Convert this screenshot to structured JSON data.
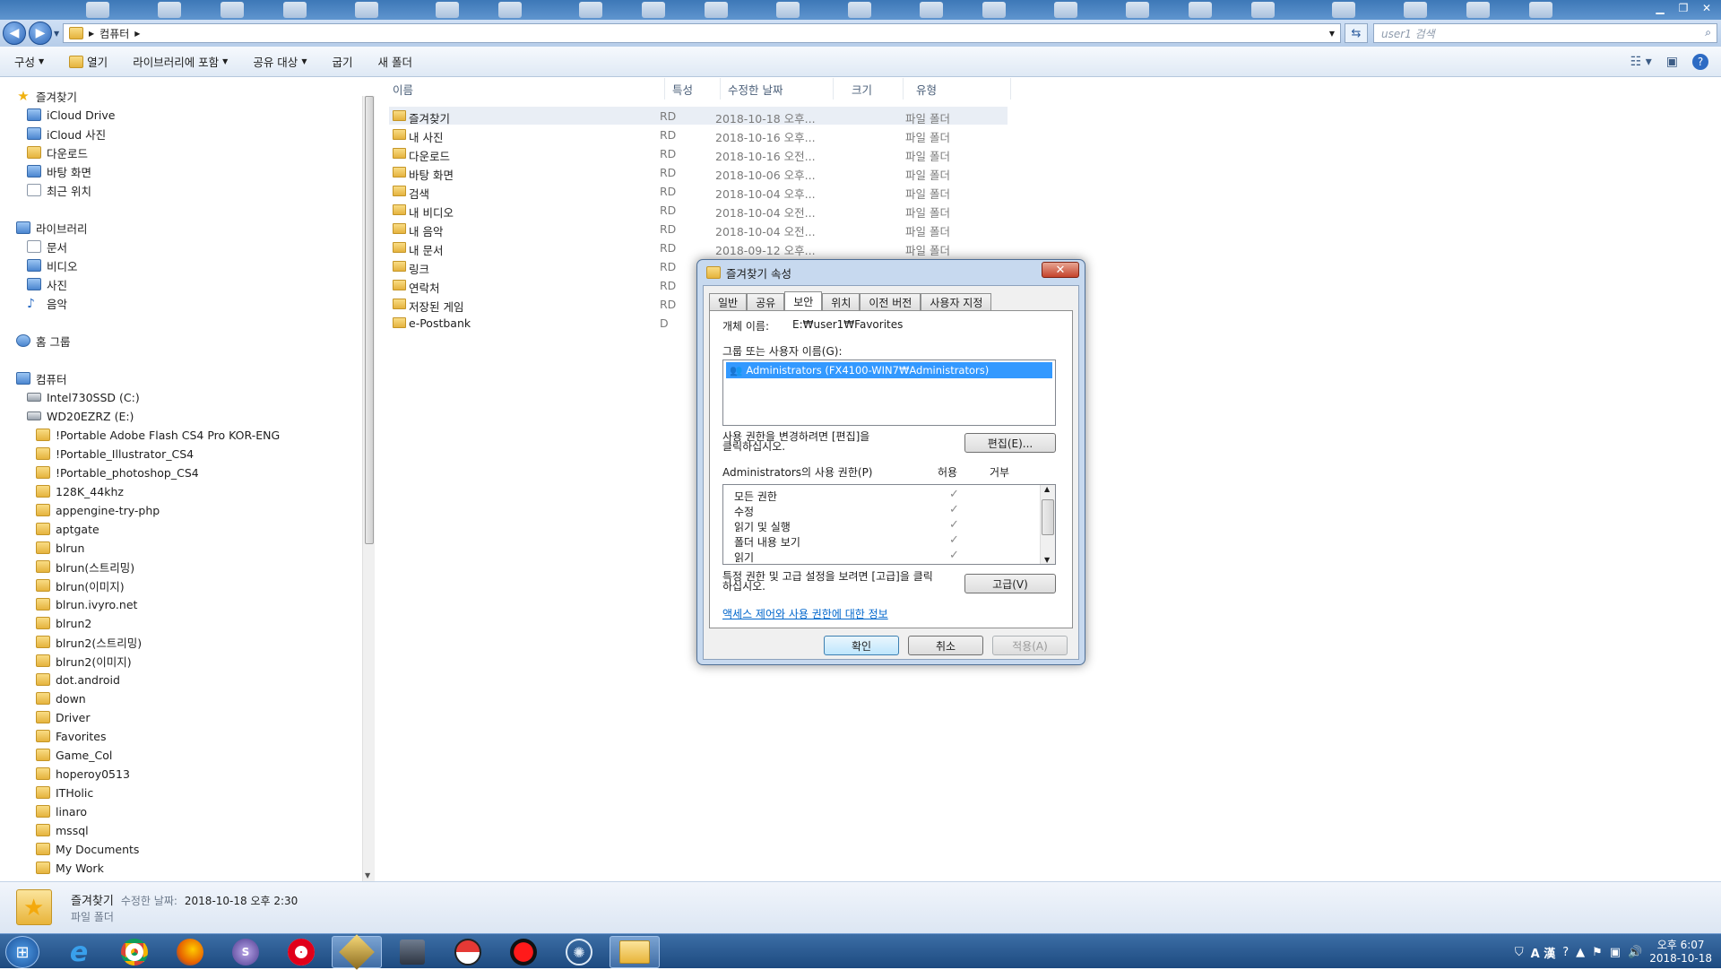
{
  "window": {
    "controls": [
      "minimize",
      "maximize",
      "close"
    ]
  },
  "address": {
    "crumb": "컴퓨터",
    "search_placeholder": "user1 검색"
  },
  "toolbar": {
    "organize": "구성",
    "open": "열기",
    "include_in_library": "라이브러리에 포함",
    "share_with": "공유 대상",
    "burn": "굽기",
    "new_folder": "새 폴더"
  },
  "nav": {
    "favorites": {
      "header": "즐겨찾기",
      "items": [
        "iCloud Drive",
        "iCloud 사진",
        "다운로드",
        "바탕 화면",
        "최근 위치"
      ]
    },
    "libraries": {
      "header": "라이브러리",
      "items": [
        "문서",
        "비디오",
        "사진",
        "음악"
      ]
    },
    "homegroup": "홈 그룹",
    "computer": {
      "header": "컴퓨터",
      "drives": [
        "Intel730SSD (C:)",
        "WD20EZRZ (E:)"
      ],
      "folders": [
        "!Portable Adobe Flash CS4 Pro KOR-ENG",
        "!Portable_Illustrator_CS4",
        "!Portable_photoshop_CS4",
        "128K_44khz",
        "appengine-try-php",
        "aptgate",
        "blrun",
        "blrun(스트리밍)",
        "blrun(이미지)",
        "blrun.ivyro.net",
        "blrun2",
        "blrun2(스트리밍)",
        "blrun2(이미지)",
        "dot.android",
        "down",
        "Driver",
        "Favorites",
        "Game_Col",
        "hoperoy0513",
        "ITHolic",
        "linaro",
        "mssql",
        "My Documents",
        "My Work"
      ]
    }
  },
  "columns": {
    "name": "이름",
    "attributes": "특성",
    "modified": "수정한 날짜",
    "size": "크기",
    "type": "유형"
  },
  "files": [
    {
      "name": "즐겨찾기",
      "attr": "RD",
      "date": "2018-10-18 오후...",
      "type": "파일 폴더"
    },
    {
      "name": "내 사진",
      "attr": "RD",
      "date": "2018-10-16 오후...",
      "type": "파일 폴더"
    },
    {
      "name": "다운로드",
      "attr": "RD",
      "date": "2018-10-16 오전...",
      "type": "파일 폴더"
    },
    {
      "name": "바탕 화면",
      "attr": "RD",
      "date": "2018-10-06 오후...",
      "type": "파일 폴더"
    },
    {
      "name": "검색",
      "attr": "RD",
      "date": "2018-10-04 오후...",
      "type": "파일 폴더"
    },
    {
      "name": "내 비디오",
      "attr": "RD",
      "date": "2018-10-04 오전...",
      "type": "파일 폴더"
    },
    {
      "name": "내 음악",
      "attr": "RD",
      "date": "2018-10-04 오전...",
      "type": "파일 폴더"
    },
    {
      "name": "내 문서",
      "attr": "RD",
      "date": "2018-09-12 오후...",
      "type": "파일 폴더"
    },
    {
      "name": "링크",
      "attr": "RD",
      "date": "",
      "type": ""
    },
    {
      "name": "연락처",
      "attr": "RD",
      "date": "",
      "type": ""
    },
    {
      "name": "저장된 게임",
      "attr": "RD",
      "date": "",
      "type": ""
    },
    {
      "name": "e-Postbank",
      "attr": "D",
      "date": "",
      "type": ""
    }
  ],
  "details": {
    "name": "즐겨찾기",
    "modified_label": "수정한 날짜:",
    "modified_value": "2018-10-18 오후 2:30",
    "type": "파일 폴더"
  },
  "dialog": {
    "title": "즐겨찾기 속성",
    "tabs": [
      "일반",
      "공유",
      "보안",
      "위치",
      "이전 버전",
      "사용자 지정"
    ],
    "active_tab": "보안",
    "object_name_label": "개체 이름:",
    "object_name_value": "E:₩user1₩Favorites",
    "group_label": "그룹 또는 사용자 이름(G):",
    "user": "Administrators (FX4100-WIN7₩Administrators)",
    "edit_hint_1": "사용 권한을 변경하려면 [편집]을",
    "edit_hint_2": "클릭하십시오.",
    "edit_button": "편집(E)...",
    "perm_label": "Administrators의 사용 권한(P)",
    "allow": "허용",
    "deny": "거부",
    "permissions": [
      "모든 권한",
      "수정",
      "읽기 및 실행",
      "폴더 내용 보기",
      "읽기"
    ],
    "check_glyph": "✓",
    "advanced_hint_1": "특정 권한 및 고급 설정을 보려면 [고급]을 클릭",
    "advanced_hint_2": "하십시오.",
    "advanced_button": "고급(V)",
    "help_link": "액세스 제어와 사용 권한에 대한 정보",
    "ok": "확인",
    "cancel": "취소",
    "apply": "적용(A)",
    "close_glyph": "✕"
  },
  "tray": {
    "ime": "A 漢",
    "time": "오후 6:07",
    "date": "2018-10-18"
  }
}
